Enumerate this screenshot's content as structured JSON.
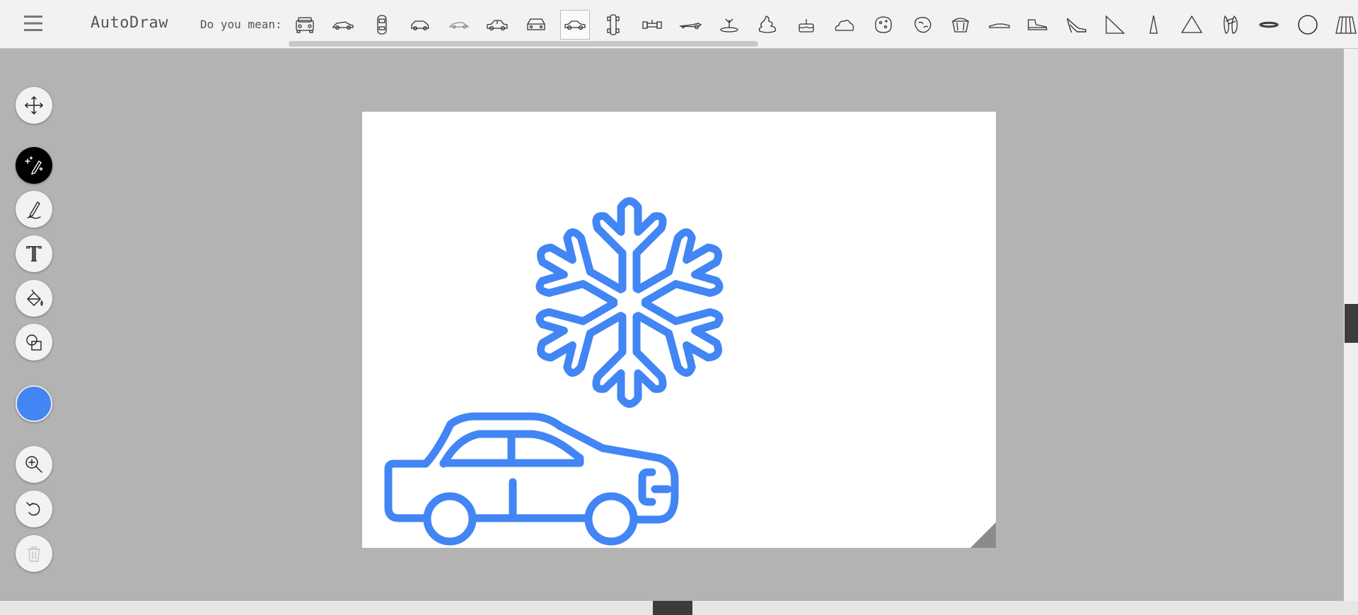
{
  "header": {
    "app_title": "AutoDraw",
    "suggest_label": "Do you mean:",
    "suggestions": [
      "suv-front-icon",
      "sports-car-icon",
      "car-top-view-icon",
      "small-car-icon",
      "outline-car-icon",
      "sedan-icon",
      "car-front-icon",
      "sedan-side-icon",
      "race-car-top-icon",
      "formula-car-icon",
      "dragster-icon",
      "plant-pot-icon",
      "swirl-icon",
      "cake-icon",
      "cloud-icon",
      "cookie-icon",
      "brain-icon",
      "cupcake-icon",
      "sneaker-icon",
      "boot-icon",
      "high-heel-icon",
      "right-triangle-icon",
      "narrow-triangle-icon",
      "triangle-icon",
      "ballet-shoes-icon",
      "ring-icon",
      "circle-icon",
      "skirt-icon"
    ],
    "selected_index": 7
  },
  "toolbar": {
    "tools": [
      "move-tool",
      "autodraw-tool",
      "draw-tool",
      "type-tool",
      "fill-tool",
      "shape-tool",
      "color-picker",
      "zoom-tool",
      "undo-tool",
      "delete-tool"
    ],
    "active_tool": "autodraw-tool",
    "current_color": "#4285f4"
  },
  "canvas": {
    "drawings": [
      "snowflake-drawing",
      "car-drawing"
    ],
    "stroke_color": "#4285f4",
    "background": "#ffffff"
  }
}
